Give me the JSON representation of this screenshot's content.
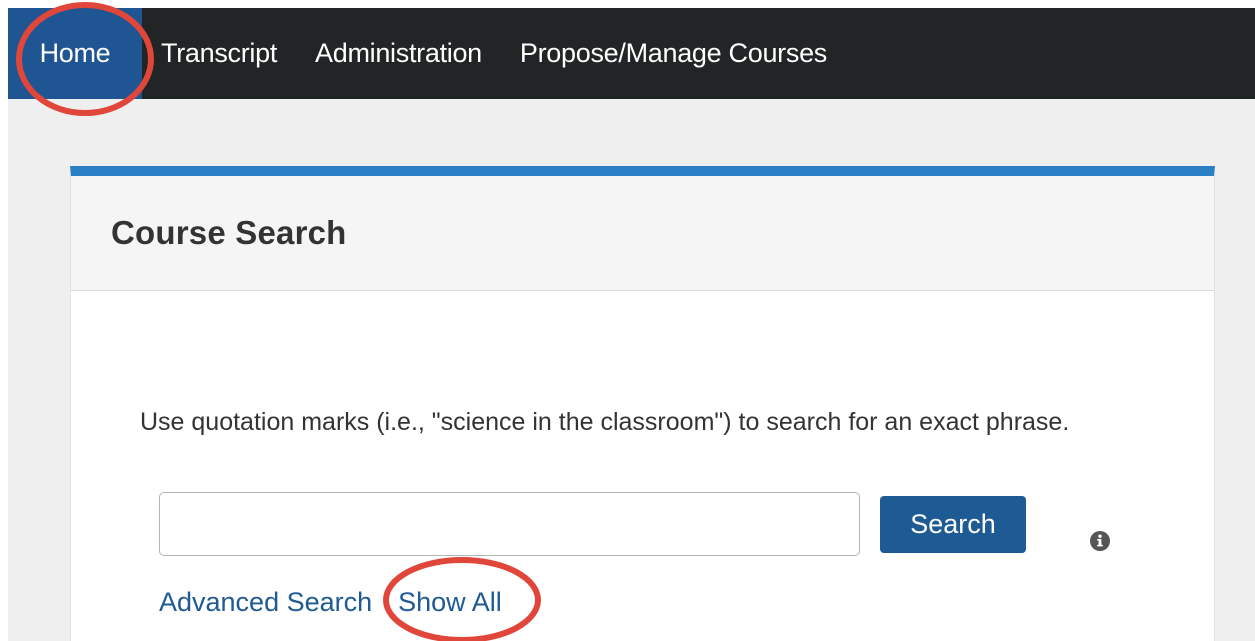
{
  "nav": {
    "items": [
      {
        "label": "Home",
        "active": true
      },
      {
        "label": "Transcript",
        "active": false
      },
      {
        "label": "Administration",
        "active": false
      },
      {
        "label": "Propose/Manage Courses",
        "active": false
      }
    ]
  },
  "course_search": {
    "title": "Course Search",
    "hint": "Use quotation marks (i.e., \"science in the classroom\") to search for an exact phrase.",
    "search_input_value": "",
    "search_button_label": "Search",
    "info_icon": "info-circle-icon",
    "advanced_search_label": "Advanced Search",
    "show_all_label": "Show All"
  },
  "colors": {
    "nav_background": "#222526",
    "nav_active": "#1f5593",
    "panel_accent": "#2b80c5",
    "button": "#1e5b94",
    "link": "#1f5a94",
    "annotation_circle": "#e0463a"
  }
}
